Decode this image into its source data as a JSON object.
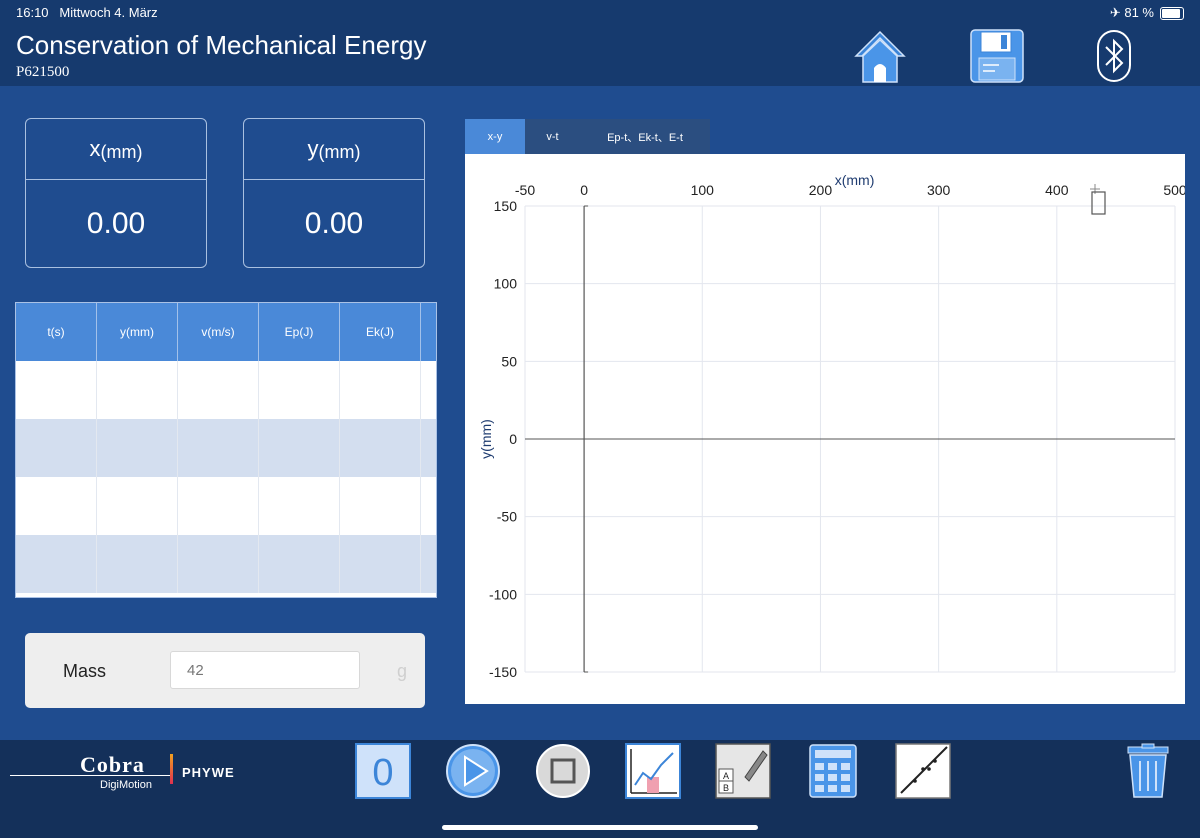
{
  "status": {
    "time": "16:10",
    "date": "Mittwoch 4. März",
    "battery": "✈ 81 %"
  },
  "header": {
    "title": "Conservation of Mechanical Energy",
    "subtitle": "P621500",
    "icons": [
      "home-icon",
      "save-icon",
      "bluetooth-icon"
    ]
  },
  "readouts": {
    "x_label": "x",
    "x_unit": "(mm)",
    "x_value": "0.00",
    "y_label": "y",
    "y_unit": "(mm)",
    "y_value": "0.00"
  },
  "table": {
    "columns": [
      "t(s)",
      "y(mm)",
      "v(m/s)",
      "Ep(J)",
      "Ek(J)"
    ],
    "rows": 4
  },
  "mass": {
    "label": "Mass",
    "value": "42",
    "unit": "g"
  },
  "tabs": [
    {
      "label": "x-y",
      "active": true
    },
    {
      "label": "v-t",
      "active": false
    },
    {
      "label": "Ep-t、Ek-t、E-t",
      "active": false
    }
  ],
  "chart_data": {
    "type": "scatter",
    "xlabel": "x(mm)",
    "ylabel": "y(mm)",
    "xlim": [
      -50,
      500
    ],
    "ylim": [
      -150,
      150
    ],
    "x_ticks": [
      -50,
      0,
      100,
      200,
      300,
      400,
      500
    ],
    "y_ticks": [
      150,
      100,
      50,
      0,
      -50,
      -100,
      -150
    ],
    "series": [],
    "grid": true
  },
  "toolbar": {
    "zero_label": "0",
    "icons": [
      "zero-button",
      "play-icon",
      "stop-icon",
      "chart-icon",
      "table-edit-icon",
      "calculator-icon",
      "fit-line-icon",
      "trash-icon"
    ]
  },
  "branding": {
    "brand": "Cobra",
    "partner": "PHYWE",
    "product": "DigiMotion"
  },
  "colors": {
    "header": "#163a6e",
    "body": "#1f4c8f",
    "accent": "#4a89d8",
    "footer": "#14305a"
  }
}
